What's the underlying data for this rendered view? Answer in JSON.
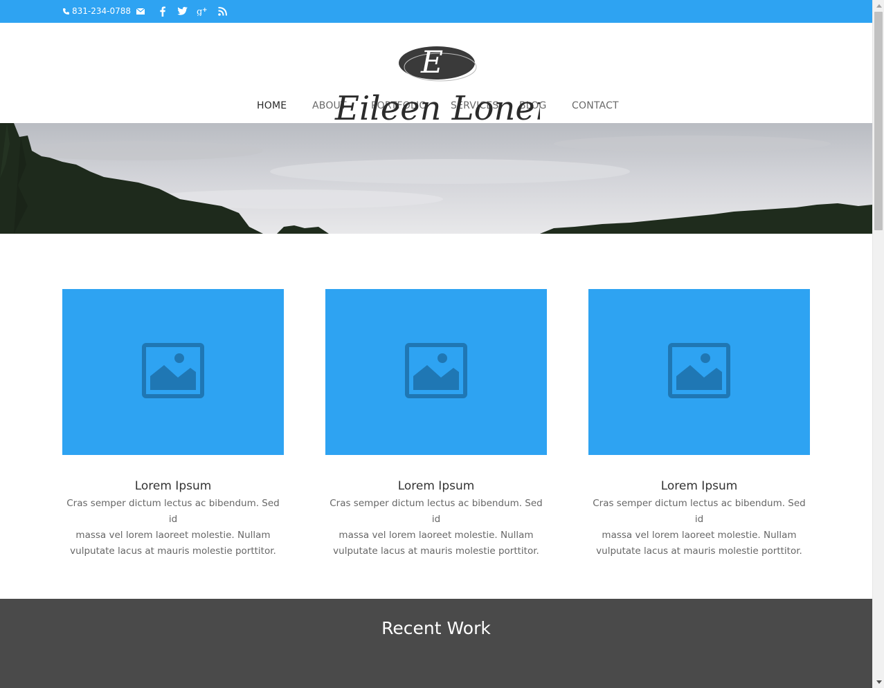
{
  "topbar": {
    "phone": "831-234-0788",
    "background": "#2ea3f2",
    "icons": [
      "phone-icon",
      "email-icon",
      "facebook-icon",
      "twitter-icon",
      "google-plus-icon",
      "rss-icon"
    ]
  },
  "header": {
    "logo_text": "Eileen Lonergan",
    "nav": [
      {
        "label": "HOME",
        "active": true
      },
      {
        "label": "ABOUT"
      },
      {
        "label": "PORTFOLIO"
      },
      {
        "label": "SERVICES"
      },
      {
        "label": "BLOG"
      },
      {
        "label": "CONTACT"
      }
    ]
  },
  "blurbs": [
    {
      "title": "Lorem Ipsum",
      "lines": [
        "Cras semper dictum lectus ac bibendum. Sed id",
        "massa vel lorem laoreet molestie. Nullam",
        "vulputate lacus at mauris molestie porttitor."
      ],
      "icon": "image-placeholder-icon"
    },
    {
      "title": "Lorem Ipsum",
      "lines": [
        "Cras semper dictum lectus ac bibendum. Sed id",
        "massa vel lorem laoreet molestie. Nullam",
        "vulputate lacus at mauris molestie porttitor."
      ],
      "icon": "image-placeholder-icon"
    },
    {
      "title": "Lorem Ipsum",
      "lines": [
        "Cras semper dictum lectus ac bibendum. Sed id",
        "massa vel lorem laoreet molestie. Nullam",
        "vulputate lacus at mauris molestie porttitor."
      ],
      "icon": "image-placeholder-icon"
    }
  ],
  "recent": {
    "title": "Recent Work"
  },
  "colors": {
    "accent": "#2ea3f2",
    "dark_section": "#4a4a4a"
  }
}
